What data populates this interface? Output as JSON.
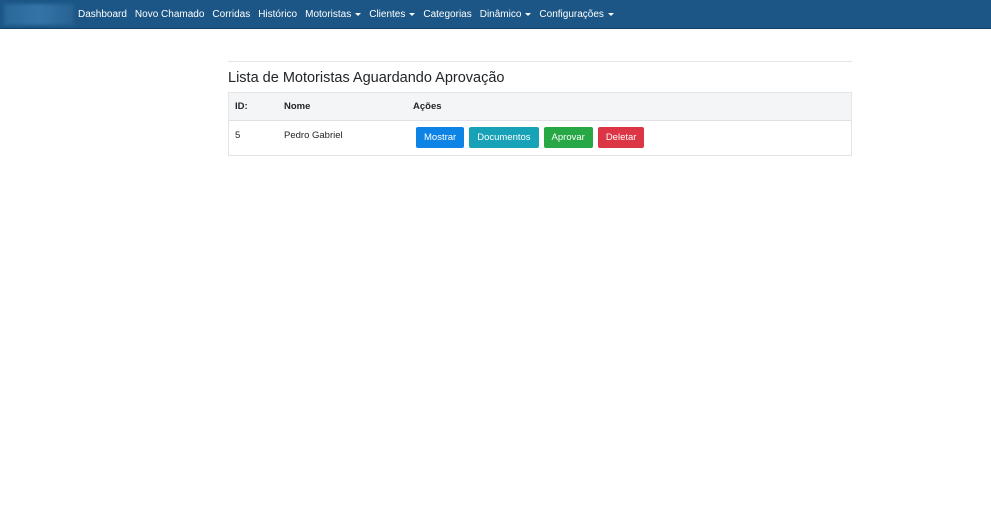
{
  "navbar": {
    "items": [
      {
        "label": "Dashboard",
        "dropdown": false
      },
      {
        "label": "Novo Chamado",
        "dropdown": false
      },
      {
        "label": "Corridas",
        "dropdown": false
      },
      {
        "label": "Histórico",
        "dropdown": false
      },
      {
        "label": "Motoristas",
        "dropdown": true
      },
      {
        "label": "Clientes",
        "dropdown": true
      },
      {
        "label": "Categorias",
        "dropdown": false
      },
      {
        "label": "Dinâmico",
        "dropdown": true
      },
      {
        "label": "Configurações",
        "dropdown": true
      }
    ],
    "color": "#1b5686"
  },
  "main": {
    "title": "Lista de Motoristas Aguardando Aprovação",
    "table": {
      "headers": {
        "id": "ID:",
        "nome": "Nome",
        "acoes": "Ações"
      },
      "rows": [
        {
          "id": "5",
          "nome": "Pedro Gabriel"
        }
      ]
    },
    "actions": {
      "mostrar": "Mostrar",
      "documentos": "Documentos",
      "aprovar": "Aprovar",
      "deletar": "Deletar"
    }
  },
  "colors": {
    "primary": "#0d83e6",
    "info": "#17a2b8",
    "success": "#28a745",
    "danger": "#dc3545"
  }
}
